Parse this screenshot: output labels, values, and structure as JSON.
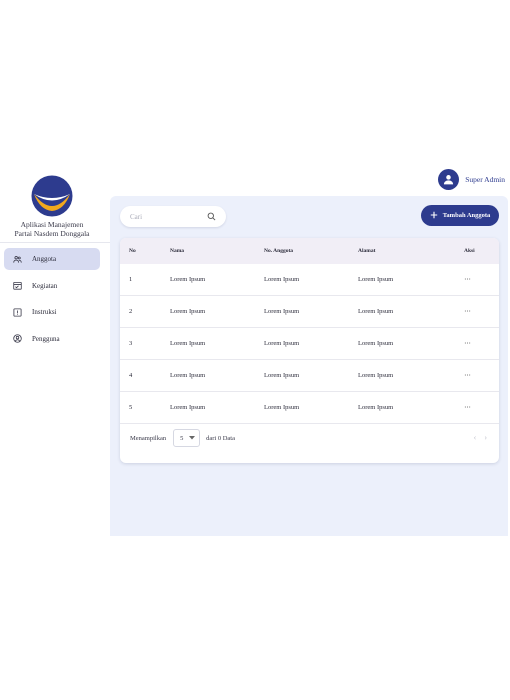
{
  "user": {
    "name": "Super Admin",
    "icon": "user-avatar-icon"
  },
  "sidebar": {
    "app_title_line1": "Aplikasi Manajemen",
    "app_title_line2": "Partai Nasdem Donggala",
    "items": [
      {
        "label": "Anggota",
        "icon": "users-icon",
        "active": true
      },
      {
        "label": "Kegiatan",
        "icon": "calendar-check-icon",
        "active": false
      },
      {
        "label": "Instruksi",
        "icon": "alert-square-icon",
        "active": false
      },
      {
        "label": "Pengguna",
        "icon": "user-circle-icon",
        "active": false
      }
    ]
  },
  "toolbar": {
    "search_placeholder": "Cari",
    "add_label": "Tambah Anggota"
  },
  "table": {
    "headers": {
      "no": "No",
      "nama": "Nama",
      "no_anggota": "No. Anggota",
      "alamat": "Alamat",
      "aksi": "Aksi"
    },
    "rows": [
      {
        "no": "1",
        "nama": "Lorem Ipsum",
        "no_anggota": "Lorem Ipsum",
        "alamat": "Lorem Ipsum",
        "aksi": "···"
      },
      {
        "no": "2",
        "nama": "Lorem Ipsum",
        "no_anggota": "Lorem Ipsum",
        "alamat": "Lorem Ipsum",
        "aksi": "···"
      },
      {
        "no": "3",
        "nama": "Lorem Ipsum",
        "no_anggota": "Lorem Ipsum",
        "alamat": "Lorem Ipsum",
        "aksi": "···"
      },
      {
        "no": "4",
        "nama": "Lorem Ipsum",
        "no_anggota": "Lorem Ipsum",
        "alamat": "Lorem Ipsum",
        "aksi": "···"
      },
      {
        "no": "5",
        "nama": "Lorem Ipsum",
        "no_anggota": "Lorem Ipsum",
        "alamat": "Lorem Ipsum",
        "aksi": "···"
      }
    ]
  },
  "pagination": {
    "showing_label": "Menampilkan",
    "per_page": "5",
    "total_label": "dari 0 Data",
    "prev": "‹",
    "next": "›"
  },
  "colors": {
    "brand": "#2d3b8e",
    "logo_orange": "#f2a81d",
    "main_bg": "#ecf0fb",
    "nav_active": "#d7dbf1"
  }
}
